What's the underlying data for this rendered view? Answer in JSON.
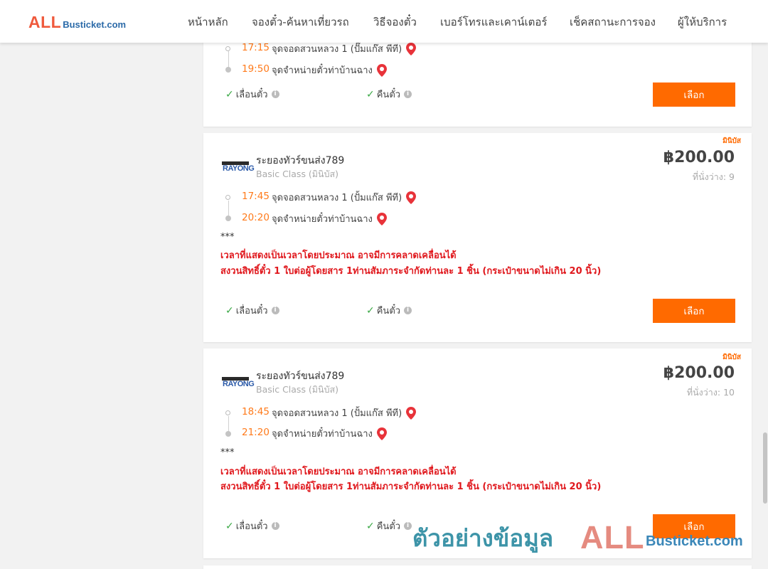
{
  "header": {
    "logo_all": "ALL",
    "logo_bt": "Busticket.com",
    "nav": [
      "หน้าหลัก",
      "จองตั๋ว-ค้นหาเที่ยวรถ",
      "วิธีจองตั๋ว",
      "เบอร์โทรและเคาน์เตอร์",
      "เช็คสถานะการจอง",
      "ผู้ให้บริการ"
    ]
  },
  "common": {
    "reschedule": "เลื่อนตั๋ว",
    "refund": "คืนตั๋ว",
    "select": "เลือก",
    "operator_logo": "RAYONG"
  },
  "trips": [
    {
      "depart_time": "17:15",
      "depart_place": "จุดจอดสวนหลวง 1 (ปั๊มแก๊ส พีที)",
      "arrive_time": "19:50",
      "arrive_place": "จุดจำหน่ายตั๋วท่าบ้านฉาง"
    },
    {
      "tag": "มินิบัส",
      "operator": "ระยองทัวร์ขนส่ง789",
      "class": "Basic Class (มินิบัส)",
      "price": "฿200.00",
      "seats": "ที่นั่งว่าง: 9",
      "depart_time": "17:45",
      "depart_place": "จุดจอดสวนหลวง 1 (ปั้มแก๊ส พีที)",
      "arrive_time": "20:20",
      "arrive_place": "จุดจำหน่ายตั๋วท่าบ้านฉาง",
      "note_mark": "***",
      "note1": "เวลาที่แสดงเป็นเวลาโดยประมาณ อาจมีการคลาดเคลื่อนได้",
      "note2": "สงวนสิทธิ์ตั๋ว 1 ใบต่อผู้โดยสาร 1ท่านสัมภาระจำกัดท่านละ 1 ชิ้น (กระเป๋าขนาดไม่เกิน 20 นิ้ว)"
    },
    {
      "tag": "มินิบัส",
      "operator": "ระยองทัวร์ขนส่ง789",
      "class": "Basic Class (มินิบัส)",
      "price": "฿200.00",
      "seats": "ที่นั่งว่าง: 10",
      "depart_time": "18:45",
      "depart_place": "จุดจอดสวนหลวง 1 (ปั้มแก๊ส พีที)",
      "arrive_time": "21:20",
      "arrive_place": "จุดจำหน่ายตั๋วท่าบ้านฉาง",
      "note_mark": "***",
      "note1": "เวลาที่แสดงเป็นเวลาโดยประมาณ อาจมีการคลาดเคลื่อนได้",
      "note2": "สงวนสิทธิ์ตั๋ว 1 ใบต่อผู้โดยสาร 1ท่านสัมภาระจำกัดท่านละ 1 ชิ้น (กระเป๋าขนาดไม่เกิน 20 นิ้ว)"
    }
  ],
  "watermark": {
    "thai": "ตัวอย่างข้อมูล",
    "all": "ALL",
    "bt": "Busticket.com"
  },
  "colors": {
    "accent": "#ff6a00",
    "time": "#ff7a1a",
    "warning": "#e0181d",
    "check": "#3aa845",
    "brand_red": "#ef5a3d",
    "brand_blue": "#2b6aa8"
  }
}
